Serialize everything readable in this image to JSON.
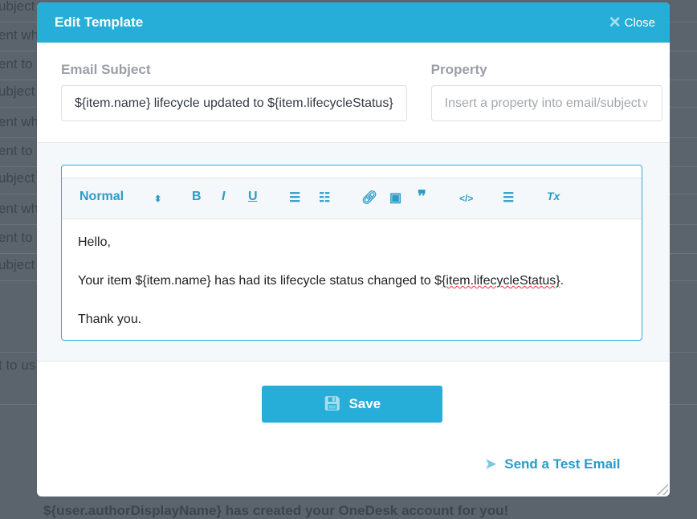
{
  "background": {
    "rows": [
      "ubject",
      "ent wh",
      "ent to",
      "ubject",
      "ent wh",
      "ent to",
      "ubject",
      "ent wh",
      "ent to",
      "ubject"
    ],
    "mid_text": "t to us",
    "footer_text": "${user.authorDisplayName} has created your OneDesk account for you!"
  },
  "modal": {
    "title": "Edit Template",
    "close_label": "Close",
    "subject": {
      "label": "Email Subject",
      "value": "${item.name} lifecycle updated to ${item.lifecycleStatus}"
    },
    "property": {
      "label": "Property",
      "placeholder": "Insert a property into email/subject"
    },
    "toolbar": {
      "format": "Normal",
      "bold": "B",
      "italic": "I",
      "underline": "U",
      "quote": "❞",
      "code": "</>",
      "clear": "Tx"
    },
    "body": {
      "line1": "Hello,",
      "line2_prefix": "Your item ${item.name} has had its lifecycle status changed to $",
      "line2_squiggle": "{item.lifecycleStatus}",
      "line2_suffix": ".",
      "line3": "Thank you."
    },
    "save_label": "Save",
    "test_label": "Send a Test Email"
  },
  "colors": {
    "accent": "#27aed8",
    "overlay": "#5b646d"
  }
}
